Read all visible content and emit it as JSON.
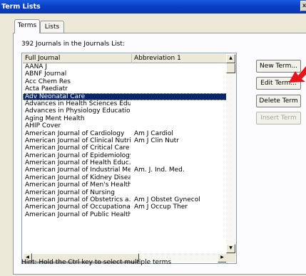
{
  "window": {
    "title": "Term Lists"
  },
  "tabs": [
    {
      "label": "Terms",
      "active": true
    },
    {
      "label": "Lists",
      "active": false
    }
  ],
  "list": {
    "count_label": "392 Journals in the Journals List:",
    "columns": [
      "Full Journal",
      "Abbreviation 1"
    ],
    "selected_index": 4,
    "rows": [
      [
        "AANA J",
        ""
      ],
      [
        "ABNF Journal",
        ""
      ],
      [
        "Acc Chem Res",
        ""
      ],
      [
        "Acta Paediatr",
        ""
      ],
      [
        "Adv Neonatal Care",
        ""
      ],
      [
        "Advances in Health Sciences Edu…",
        ""
      ],
      [
        "Advances in Physiology Education",
        ""
      ],
      [
        "Aging Ment Health",
        ""
      ],
      [
        "AHIP Cover",
        ""
      ],
      [
        "American Journal of Cardiology",
        "Am J Cardiol"
      ],
      [
        "American Journal of Clinical Nutrit…",
        "Am J Clin Nutr"
      ],
      [
        "American Journal of Critical Care",
        ""
      ],
      [
        "American Journal of Epidemiology",
        ""
      ],
      [
        "American Journal of Health Educ…",
        ""
      ],
      [
        "American Journal of Industrial Me…",
        "Am. J. Ind. Med."
      ],
      [
        "American Journal of Kidney Disea…",
        ""
      ],
      [
        "American Journal of Men's Health",
        ""
      ],
      [
        "American Journal of Nursing",
        ""
      ],
      [
        "American Journal of Obstetrics a…",
        "Am J Obstet Gynecol"
      ],
      [
        "American Journal of Occupational…",
        "Am J Occup Ther"
      ],
      [
        "American Journal of Public Health",
        ""
      ]
    ]
  },
  "buttons": {
    "new_term": "New Term...",
    "edit_term": "Edit Term...",
    "delete_term": "Delete Term",
    "insert_term": "Insert Term"
  },
  "hint": "Hint: Hold the Ctrl key to select multiple terms",
  "colors": {
    "selection": "#0a246a",
    "titlebar": "#0a3fc6",
    "arrow": "#e8141c"
  },
  "icons": {
    "scroll_up": "▲",
    "scroll_down": "▼",
    "scroll_left": "◀",
    "scroll_right": "▶",
    "close": "x"
  }
}
